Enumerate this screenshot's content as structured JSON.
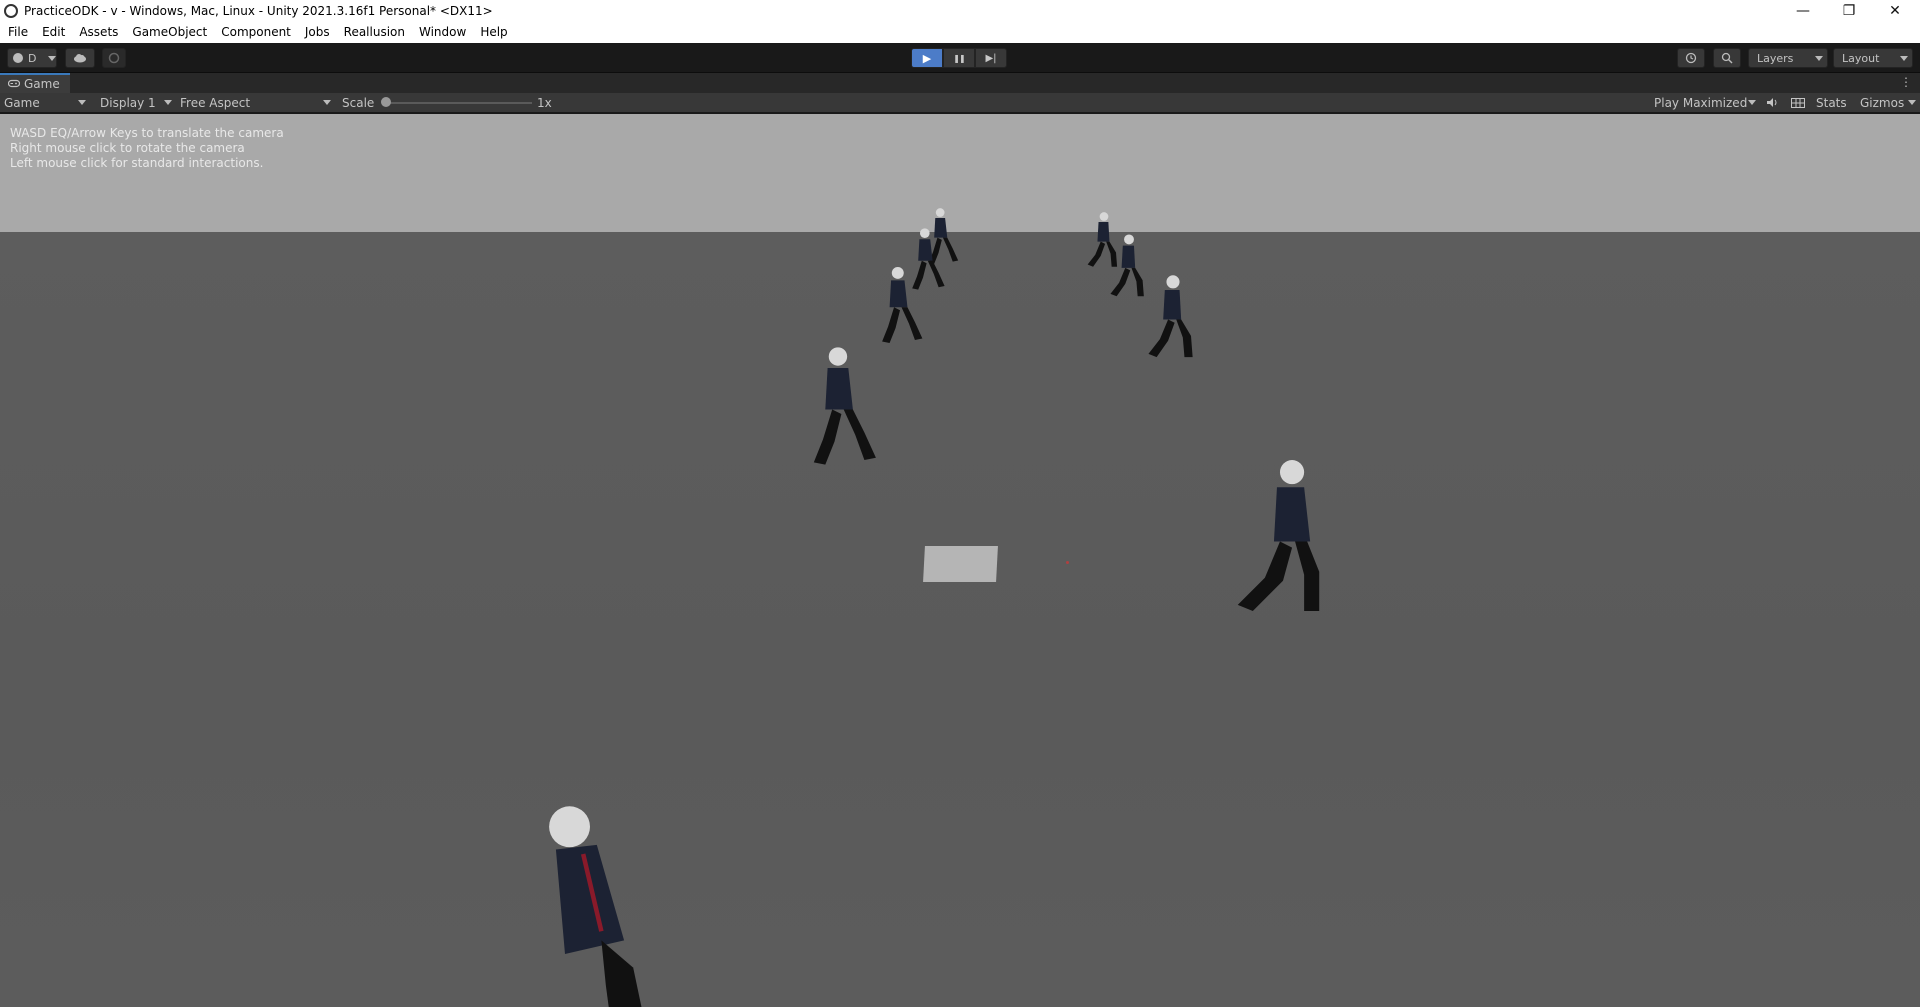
{
  "window": {
    "title": "PracticeODK - v - Windows, Mac, Linux - Unity 2021.3.16f1 Personal* <DX11>",
    "controls": {
      "minimize": "—",
      "restore": "❐",
      "close": "✕"
    }
  },
  "menu": [
    "File",
    "Edit",
    "Assets",
    "GameObject",
    "Component",
    "Jobs",
    "Reallusion",
    "Window",
    "Help"
  ],
  "toolbar": {
    "account_label": "D",
    "play_icons": {
      "play": "▶",
      "pause": "❚❚",
      "step": "▶|"
    },
    "layers_label": "Layers",
    "layout_label": "Layout"
  },
  "tab": {
    "label": "Game"
  },
  "gamebar": {
    "mode": "Game",
    "display": "Display 1",
    "aspect": "Free Aspect",
    "scale_label": "Scale",
    "scale_value": "1x",
    "play_mode": "Play Maximized",
    "stats": "Stats",
    "gizmos": "Gizmos"
  },
  "viewport": {
    "help_lines": [
      "WASD EQ/Arrow Keys to translate the camera",
      "Right mouse click to rotate the camera",
      "Left mouse click for standard interactions."
    ]
  },
  "colors": {
    "sky": "#a9a9a9",
    "ground": "#5c5c5c",
    "play_active": "#4c7cc8",
    "suit": "#1c2233"
  }
}
